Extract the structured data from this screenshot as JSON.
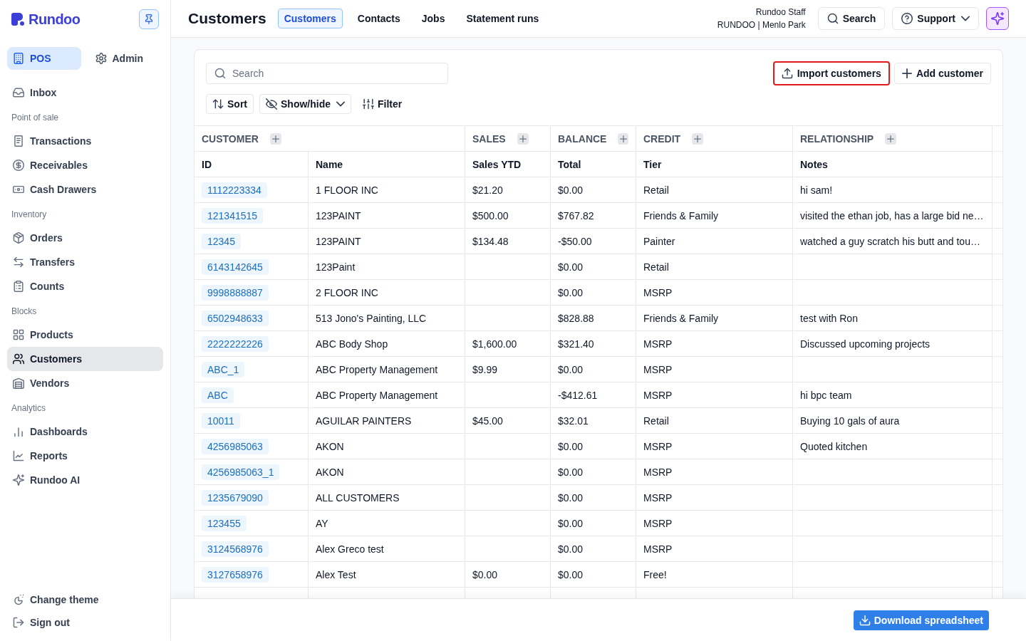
{
  "sidebar": {
    "logo": "Rundoo",
    "modes": [
      {
        "label": "POS",
        "selected": true
      },
      {
        "label": "Admin",
        "selected": false
      }
    ],
    "sections": [
      {
        "items": [
          {
            "label": "Inbox",
            "selected": false
          }
        ]
      },
      {
        "title": "Point of sale",
        "items": [
          {
            "label": "Transactions",
            "selected": false
          },
          {
            "label": "Receivables",
            "selected": false
          },
          {
            "label": "Cash Drawers",
            "selected": false
          }
        ]
      },
      {
        "title": "Inventory",
        "items": [
          {
            "label": "Orders",
            "selected": false
          },
          {
            "label": "Transfers",
            "selected": false
          },
          {
            "label": "Counts",
            "selected": false
          }
        ]
      },
      {
        "title": "Blocks",
        "items": [
          {
            "label": "Products",
            "selected": false
          },
          {
            "label": "Customers",
            "selected": true
          },
          {
            "label": "Vendors",
            "selected": false
          }
        ]
      },
      {
        "title": "Analytics",
        "items": [
          {
            "label": "Dashboards",
            "selected": false
          },
          {
            "label": "Reports",
            "selected": false
          },
          {
            "label": "Rundoo AI",
            "selected": false
          }
        ]
      }
    ],
    "footer_items": [
      {
        "label": "Change theme"
      },
      {
        "label": "Sign out"
      }
    ]
  },
  "header": {
    "title": "Customers",
    "tabs": [
      {
        "label": "Customers",
        "selected": true
      },
      {
        "label": "Contacts",
        "selected": false
      },
      {
        "label": "Jobs",
        "selected": false
      },
      {
        "label": "Statement runs",
        "selected": false
      }
    ],
    "user": {
      "name": "Rundoo Staff",
      "store": "RUNDOO | Menlo Park"
    },
    "search_button": "Search",
    "support_button": "Support"
  },
  "customers_panel": {
    "search": {
      "placeholder": "Search"
    },
    "actions": [
      {
        "label": "Import customers",
        "highlighted": true
      },
      {
        "label": "Add customer",
        "highlighted": false
      }
    ],
    "view_controls": [
      {
        "label": "Sort",
        "kind": "button"
      },
      {
        "label": "Show/hide",
        "kind": "dropdown"
      },
      {
        "label": "Filter",
        "kind": "plain"
      }
    ],
    "table": {
      "column_groups": [
        {
          "label": "CUSTOMER",
          "columns": [
            "ID",
            "Name"
          ]
        },
        {
          "label": "SALES",
          "columns": [
            "Sales YTD"
          ]
        },
        {
          "label": "BALANCE",
          "columns": [
            "Total"
          ]
        },
        {
          "label": "CREDIT",
          "columns": [
            "Tier"
          ]
        },
        {
          "label": "RELATIONSHIP",
          "columns": [
            "Notes"
          ]
        }
      ],
      "rows": [
        {
          "id": "1112223334",
          "name": "1 FLOOR INC",
          "sales_ytd": "$21.20",
          "total": "$0.00",
          "tier": "Retail",
          "notes": "hi sam!"
        },
        {
          "id": "121341515",
          "name": "123PAINT",
          "sales_ytd": "$500.00",
          "total": "$767.82",
          "tier": "Friends & Family",
          "notes": "visited the ethan job, has a large bid ne…"
        },
        {
          "id": "12345",
          "name": "123PAINT",
          "sales_ytd": "$134.48",
          "total": "-$50.00",
          "tier": "Painter",
          "notes": "watched a guy scratch his butt and tou…"
        },
        {
          "id": "6143142645",
          "name": "123Paint",
          "total": "$0.00",
          "tier": "Retail"
        },
        {
          "id": "9998888887",
          "name": "2 FLOOR INC",
          "total": "$0.00",
          "tier": "MSRP"
        },
        {
          "id": "6502948633",
          "name": "513 Jono's Painting, LLC",
          "total": "$828.88",
          "tier": "Friends & Family",
          "notes": "test with Ron"
        },
        {
          "id": "2222222226",
          "name": "ABC Body Shop",
          "sales_ytd": "$1,600.00",
          "total": "$321.40",
          "tier": "MSRP",
          "notes": "Discussed upcoming projects"
        },
        {
          "id": "ABC_1",
          "name": "ABC Property Management",
          "sales_ytd": "$9.99",
          "total": "$0.00",
          "tier": "MSRP"
        },
        {
          "id": "ABC",
          "name": "ABC Property Management",
          "total": "-$412.61",
          "tier": "MSRP",
          "notes": "hi bpc team"
        },
        {
          "id": "10011",
          "name": "AGUILAR PAINTERS",
          "sales_ytd": "$45.00",
          "total": "$32.01",
          "tier": "Retail",
          "notes": "Buying 10 gals of aura"
        },
        {
          "id": "4256985063",
          "name": "AKON",
          "total": "$0.00",
          "tier": "MSRP",
          "notes": "Quoted kitchen"
        },
        {
          "id": "4256985063_1",
          "name": "AKON",
          "total": "$0.00",
          "tier": "MSRP"
        },
        {
          "id": "1235679090",
          "name": "ALL CUSTOMERS",
          "total": "$0.00",
          "tier": "MSRP"
        },
        {
          "id": "123455",
          "name": "AY",
          "total": "$0.00",
          "tier": "MSRP"
        },
        {
          "id": "3124568976",
          "name": "Alex Greco test",
          "total": "$0.00",
          "tier": "MSRP"
        },
        {
          "id": "3127658976",
          "name": "Alex Test",
          "sales_ytd": "$0.00",
          "total": "$0.00",
          "tier": "Free!"
        }
      ]
    }
  },
  "footer": {
    "download_button": "Download spreadsheet"
  }
}
